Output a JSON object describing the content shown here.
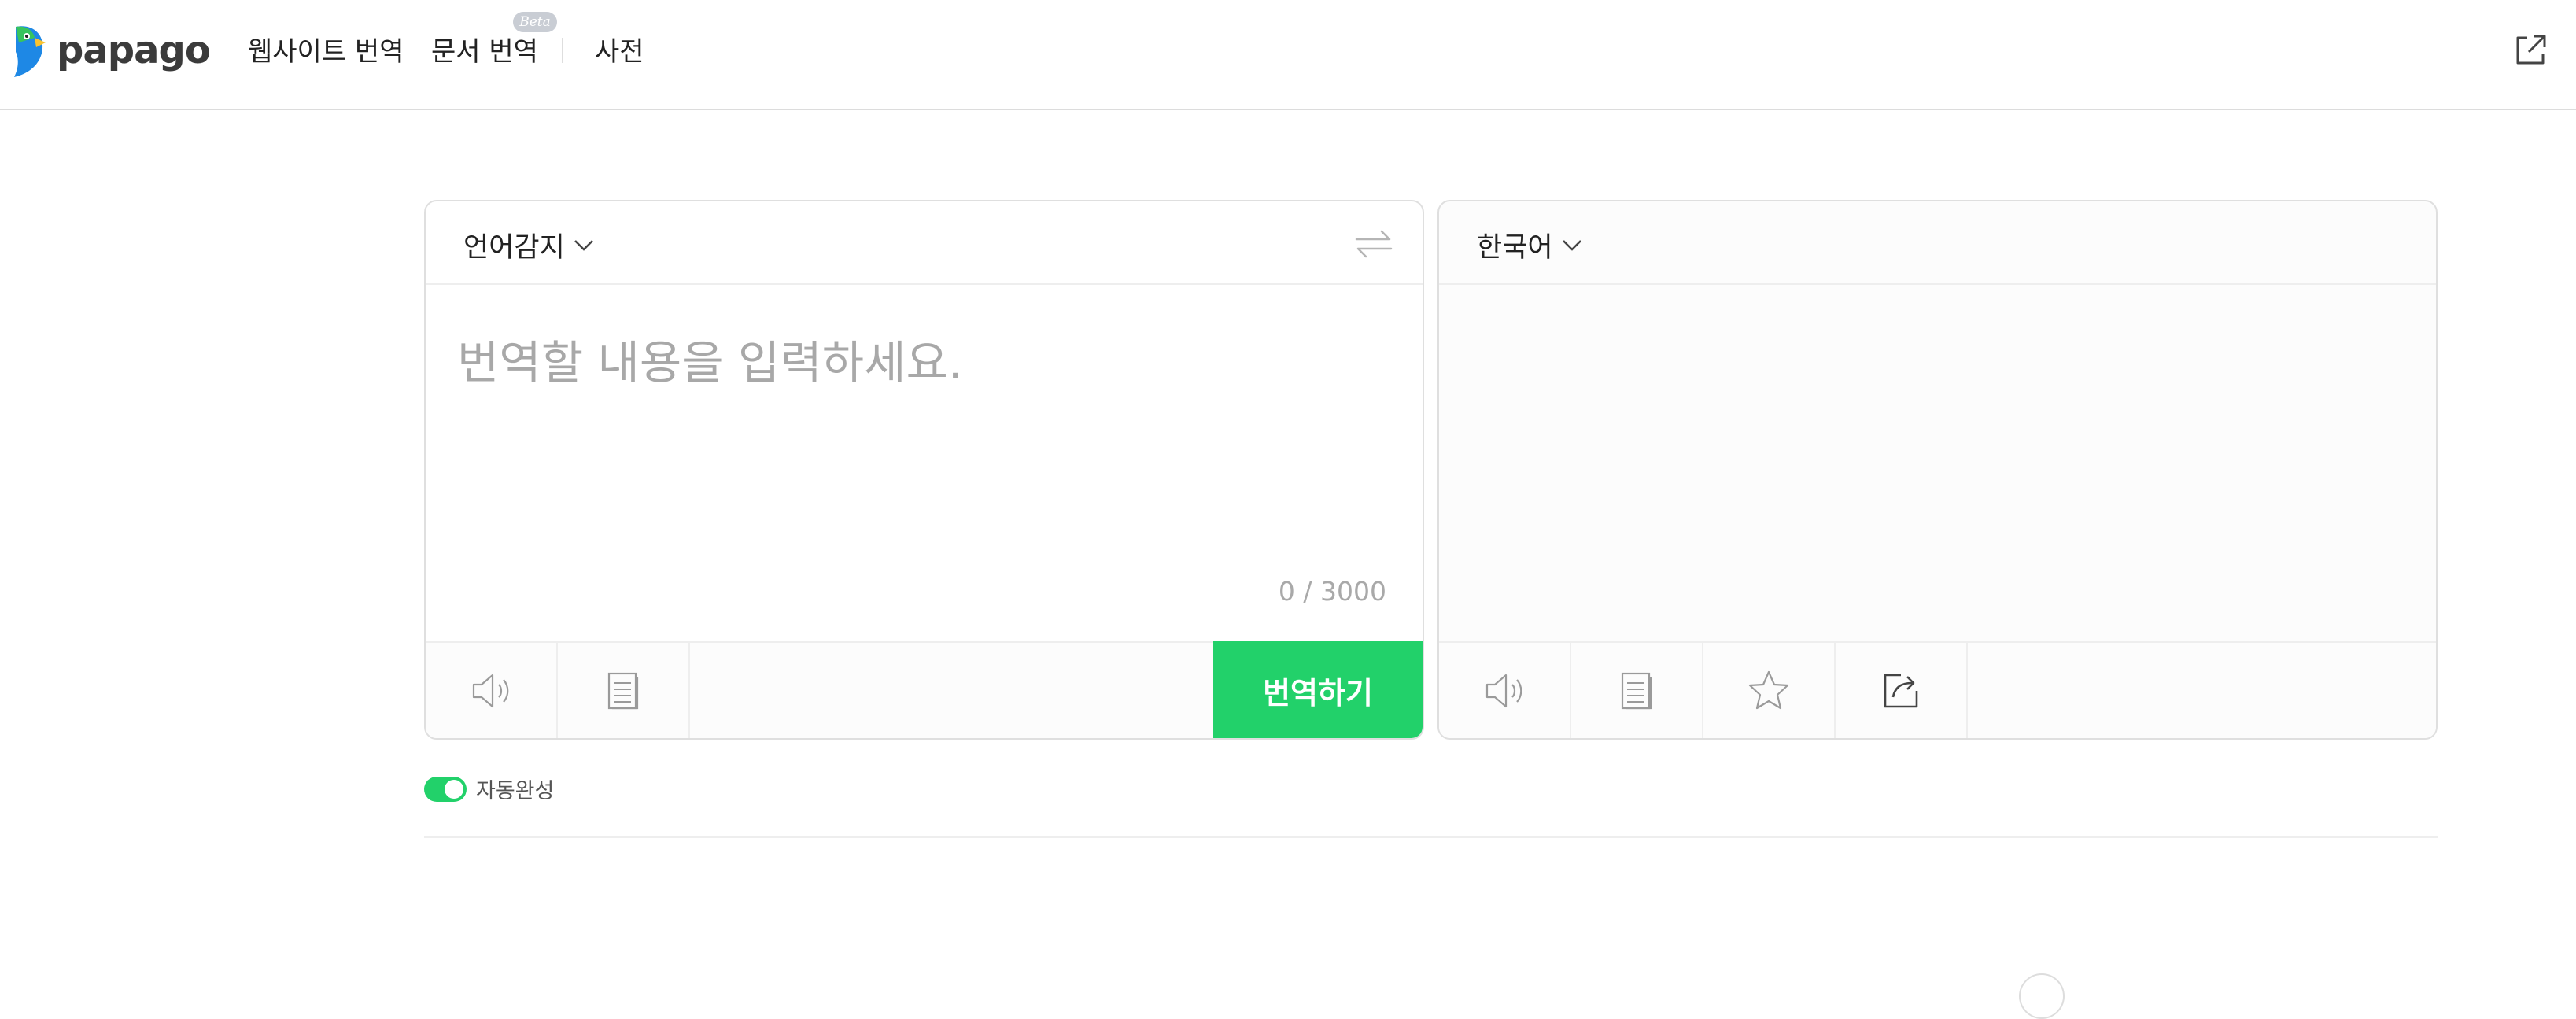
{
  "header": {
    "logo_text": "papago",
    "nav": {
      "website_translation": "웹사이트 번역",
      "document_translation": "문서 번역",
      "beta_badge": "Beta",
      "dictionary": "사전"
    },
    "external_link_icon": "external-link-icon"
  },
  "source_panel": {
    "language": "언어감지",
    "placeholder": "번역할 내용을 입력하세요.",
    "char_count": "0 / 3000",
    "translate_button": "번역하기",
    "icons": [
      "speaker-icon",
      "document-icon",
      "swap-icon",
      "chevron-down-icon"
    ]
  },
  "target_panel": {
    "language": "한국어",
    "icons": [
      "speaker-icon",
      "document-icon",
      "star-icon",
      "share-icon"
    ]
  },
  "autocomplete": {
    "label": "자동완성",
    "enabled": true
  },
  "colors": {
    "accent_green": "#22d16a",
    "logo_blue": "#1e88e5",
    "logo_green": "#37c45d",
    "logo_yellow": "#f9c22e"
  }
}
